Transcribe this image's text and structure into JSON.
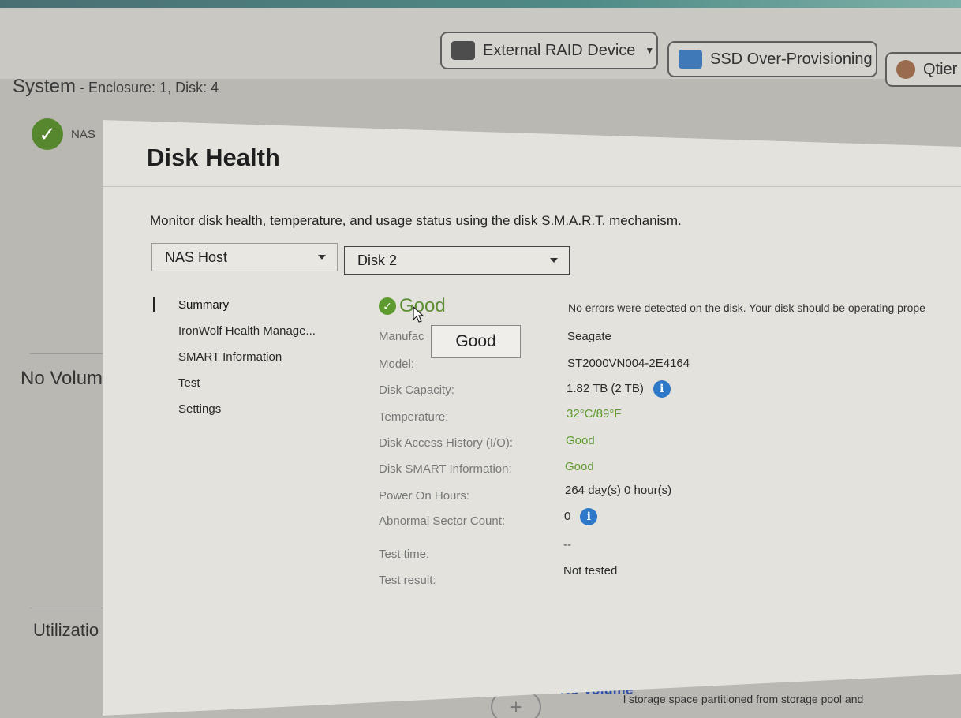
{
  "background": {
    "toolbar": {
      "external_raid": "External RAID Device",
      "ssd_overprovisioning": "SSD Over-Provisioning",
      "qtier": "Qtier"
    },
    "system_title": "System",
    "system_sub": " - Enclosure: 1, Disk: 4",
    "nas_label": "NAS",
    "no_volume_left": "No Volum",
    "utilization": "Utilizatio",
    "no_volume_bottom": "No Volume",
    "bottom_desc": "l storage space partitioned from storage pool and"
  },
  "dialog": {
    "title": "Disk Health",
    "description": "Monitor disk health, temperature, and usage status using the disk S.M.A.R.T. mechanism.",
    "host_select": "NAS Host",
    "disk_select": "Disk 2",
    "sidebar": [
      {
        "label": "Summary"
      },
      {
        "label": "IronWolf Health Manage..."
      },
      {
        "label": "SMART Information"
      },
      {
        "label": "Test"
      },
      {
        "label": "Settings"
      }
    ],
    "status": "Good",
    "status_message": "No errors were detected on the disk. Your disk should be operating prope",
    "tooltip": "Good",
    "fields": {
      "manufacturer_label": "Manufac",
      "manufacturer": "Seagate",
      "model_label": "Model:",
      "model": "ST2000VN004-2E4164",
      "capacity_label": "Disk Capacity:",
      "capacity": "1.82 TB (2 TB)",
      "temperature_label": "Temperature:",
      "temperature": "32°C/89°F",
      "access_label": "Disk Access History (I/O):",
      "access": "Good",
      "smart_label": "Disk SMART Information:",
      "smart": "Good",
      "power_label": "Power On Hours:",
      "power": "264 day(s) 0 hour(s)",
      "sector_label": "Abnormal Sector Count:",
      "sector": "0",
      "test_time_label": "Test time:",
      "test_time": "--",
      "test_result_label": "Test result:",
      "test_result": "Not tested"
    }
  },
  "colors": {
    "good_green": "#5e9a2e",
    "info_blue": "#2d78c8",
    "dialog_bg": "#e3e2dd"
  },
  "icons": [
    "raid-device-icon",
    "ssd-icon",
    "qtier-icon",
    "check-circle-icon",
    "info-icon",
    "mouse-cursor-icon",
    "plus-icon"
  ]
}
